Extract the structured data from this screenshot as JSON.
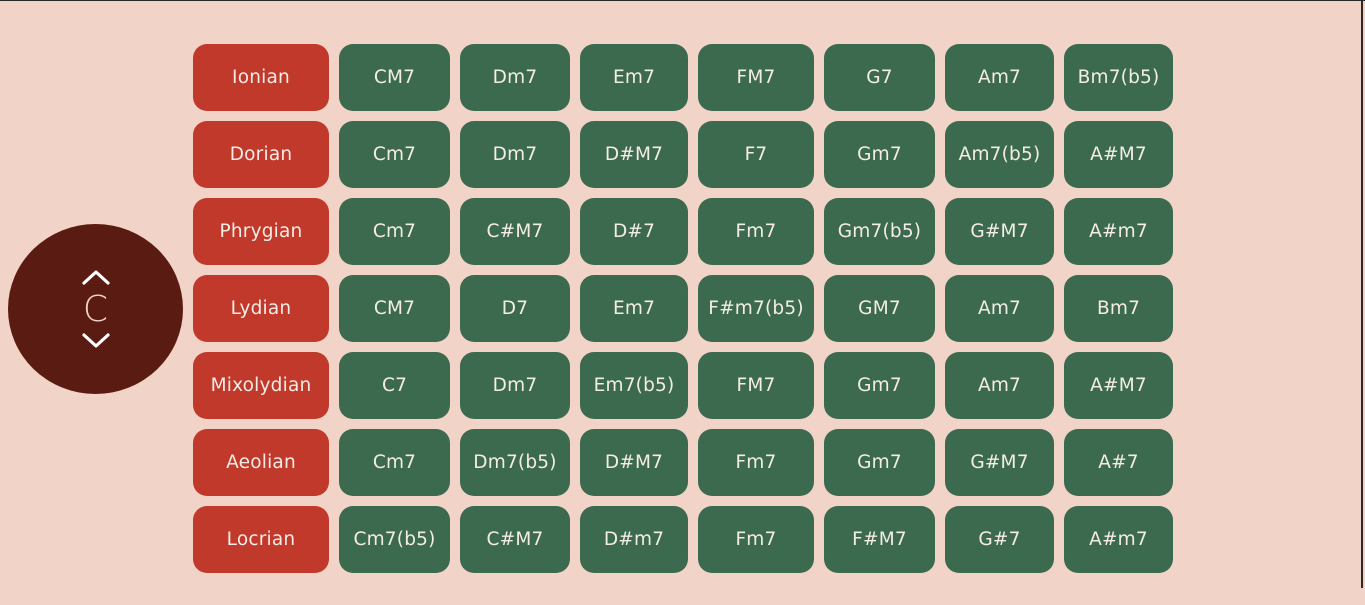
{
  "key_selector": {
    "key": "C",
    "up_icon": "chevron-up-icon",
    "down_icon": "chevron-down-icon"
  },
  "colors": {
    "background": "#f2d3c7",
    "knob": "#5a1c12",
    "mode": "#c0392b",
    "chord": "#3c6a4f",
    "text": "#f4ece6"
  },
  "modes": [
    {
      "name": "Ionian",
      "chords": [
        "CM7",
        "Dm7",
        "Em7",
        "FM7",
        "G7",
        "Am7",
        "Bm7(b5)"
      ]
    },
    {
      "name": "Dorian",
      "chords": [
        "Cm7",
        "Dm7",
        "D#M7",
        "F7",
        "Gm7",
        "Am7(b5)",
        "A#M7"
      ]
    },
    {
      "name": "Phrygian",
      "chords": [
        "Cm7",
        "C#M7",
        "D#7",
        "Fm7",
        "Gm7(b5)",
        "G#M7",
        "A#m7"
      ]
    },
    {
      "name": "Lydian",
      "chords": [
        "CM7",
        "D7",
        "Em7",
        "F#m7(b5)",
        "GM7",
        "Am7",
        "Bm7"
      ]
    },
    {
      "name": "Mixolydian",
      "chords": [
        "C7",
        "Dm7",
        "Em7(b5)",
        "FM7",
        "Gm7",
        "Am7",
        "A#M7"
      ]
    },
    {
      "name": "Aeolian",
      "chords": [
        "Cm7",
        "Dm7(b5)",
        "D#M7",
        "Fm7",
        "Gm7",
        "G#M7",
        "A#7"
      ]
    },
    {
      "name": "Locrian",
      "chords": [
        "Cm7(b5)",
        "C#M7",
        "D#m7",
        "Fm7",
        "F#M7",
        "G#7",
        "A#m7"
      ]
    }
  ]
}
